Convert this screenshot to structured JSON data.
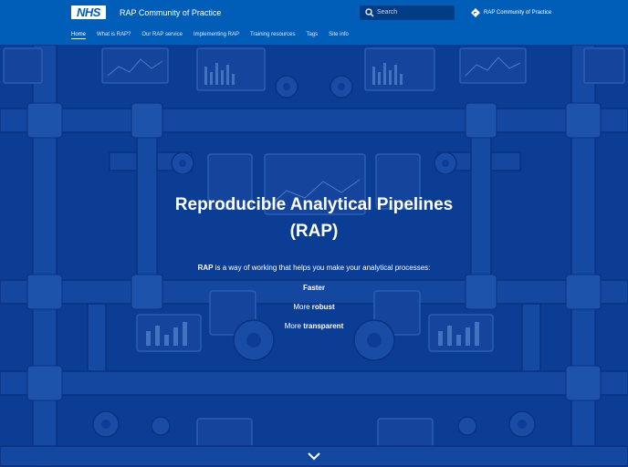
{
  "header": {
    "logo_text": "NHS",
    "site_title": "RAP Community of Practice",
    "search_placeholder": "Search",
    "right_link": "RAP Community of Practice"
  },
  "nav": [
    {
      "label": "Home"
    },
    {
      "label": "What is RAP?"
    },
    {
      "label": "Our RAP service"
    },
    {
      "label": "Implementing RAP"
    },
    {
      "label": "Training resources"
    },
    {
      "label": "Tags"
    },
    {
      "label": "Site info"
    }
  ],
  "hero": {
    "title_line1": "Reproducible Analytical Pipelines",
    "title_line2": "(RAP)",
    "intro_bold": "RAP",
    "intro_rest": " is a way of working that helps you make your analytical processes:",
    "item1_bold": "Faster",
    "item2_pre": "More ",
    "item2_bold": "robust",
    "item3_pre": "More ",
    "item3_bold": "transparent"
  },
  "colors": {
    "header_bg": "#005eb8",
    "hero_bg": "#0d3f97",
    "search_bg": "#003d87"
  },
  "icons": {
    "search": "search-icon",
    "right_link": "diamond-arrow-icon",
    "scroll": "chevron-down-icon"
  }
}
